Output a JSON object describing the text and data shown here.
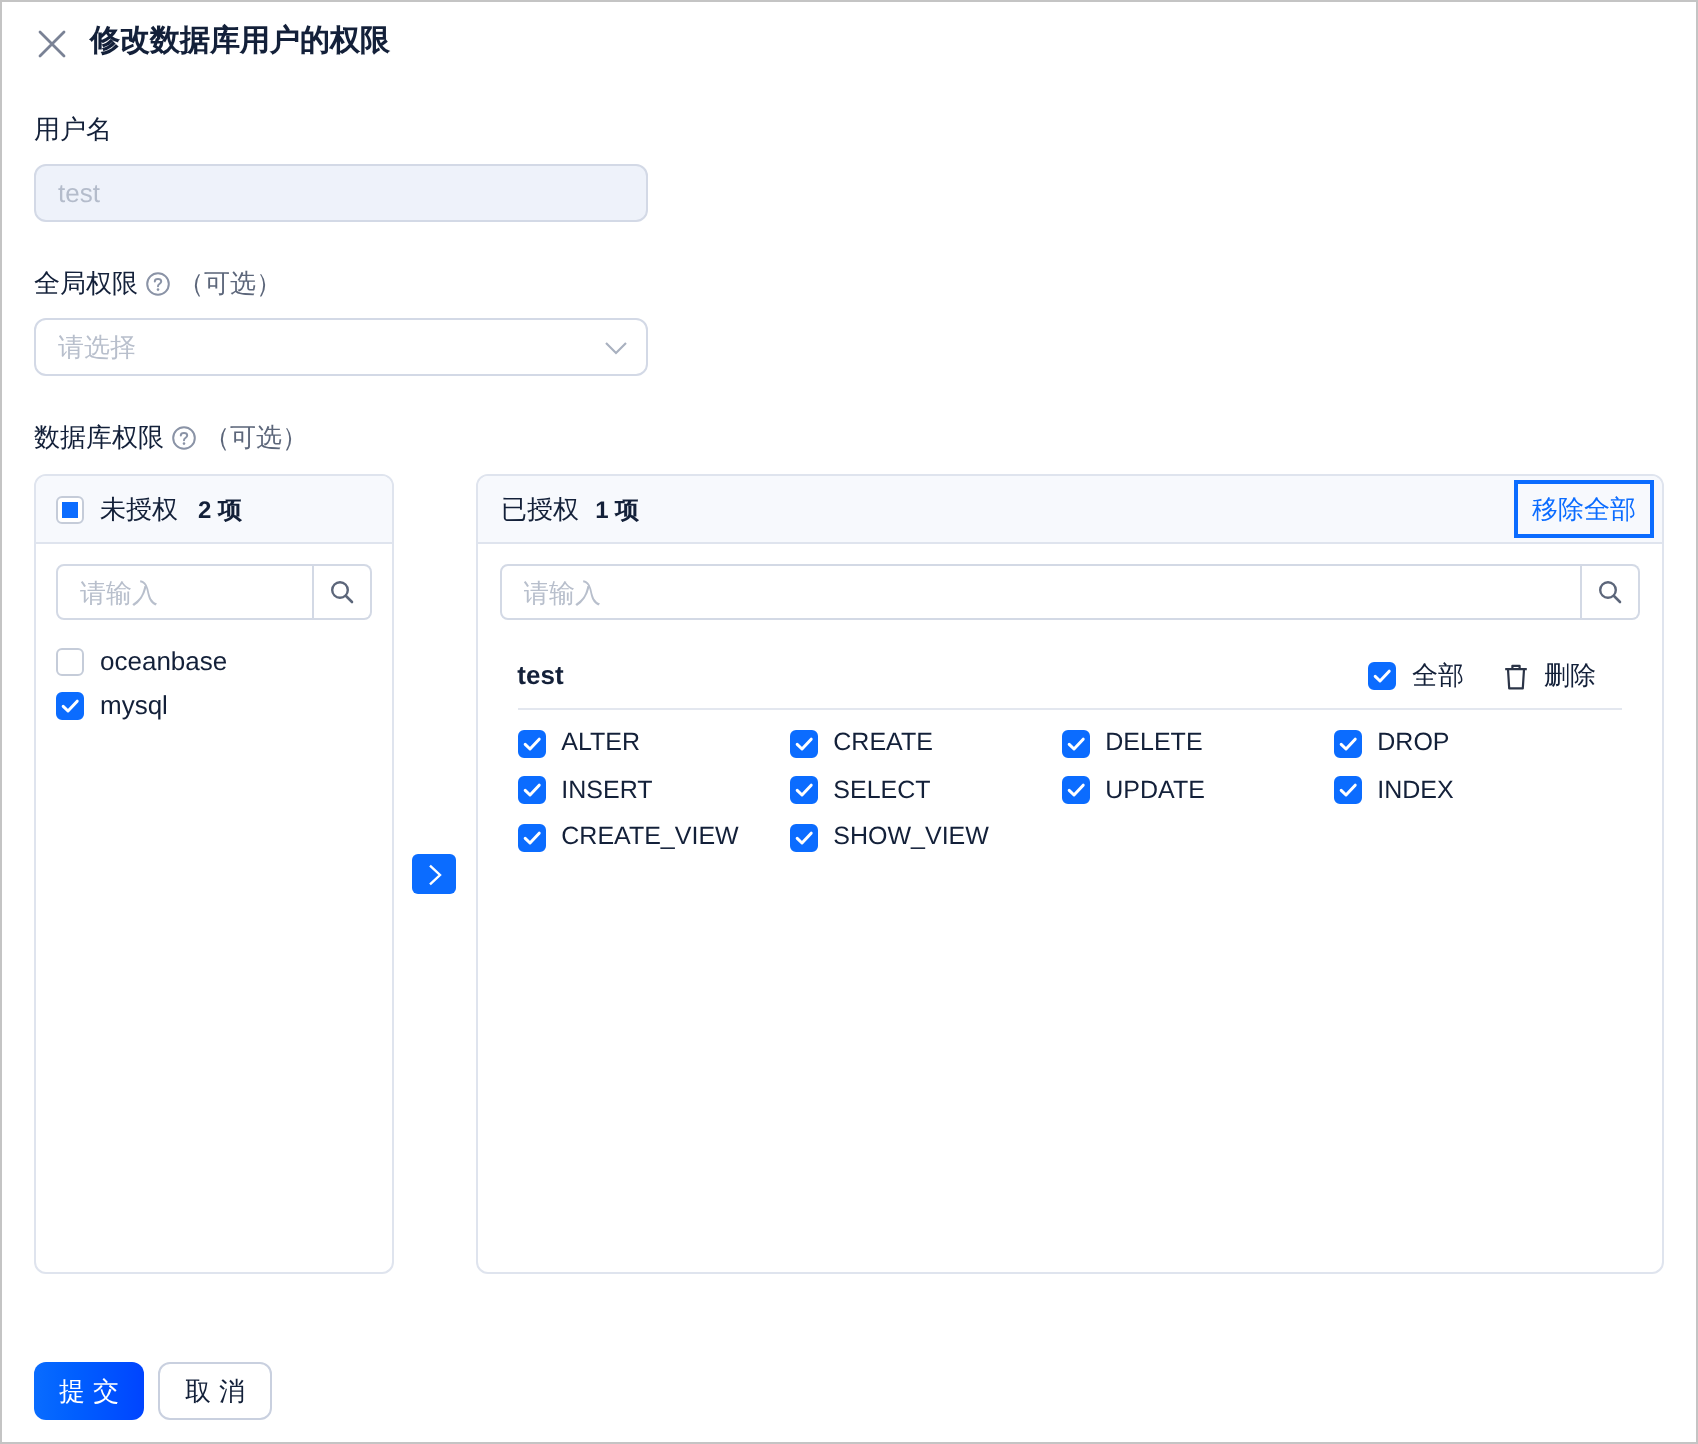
{
  "window": {
    "title": "修改数据库用户的权限"
  },
  "username": {
    "label": "用户名",
    "value": "test",
    "disabled": true
  },
  "global_privileges": {
    "label": "全局权限",
    "optional": "（可选）",
    "placeholder": "请选择"
  },
  "database_privileges": {
    "label": "数据库权限",
    "optional": "（可选）",
    "source": {
      "title": "未授权",
      "count": "2 项",
      "select_all": {
        "checked": false,
        "indeterminate": true
      },
      "search_placeholder": "请输入",
      "items": [
        {
          "label": "oceanbase",
          "checked": false
        },
        {
          "label": "mysql",
          "checked": true
        }
      ]
    },
    "target": {
      "title": "已授权",
      "count": "1 项",
      "remove_all": {
        "label": "移除全部",
        "focused": true
      },
      "search_placeholder": "请输入",
      "groups": [
        {
          "name": "test",
          "select_all": {
            "label": "全部",
            "checked": true
          },
          "delete_label": "删除",
          "privileges": [
            {
              "label": "ALTER",
              "checked": true
            },
            {
              "label": "CREATE",
              "checked": true
            },
            {
              "label": "DELETE",
              "checked": true
            },
            {
              "label": "DROP",
              "checked": true
            },
            {
              "label": "INSERT",
              "checked": true
            },
            {
              "label": "SELECT",
              "checked": true
            },
            {
              "label": "UPDATE",
              "checked": true
            },
            {
              "label": "INDEX",
              "checked": true
            },
            {
              "label": "CREATE_VIEW",
              "checked": true
            },
            {
              "label": "SHOW_VIEW",
              "checked": true
            }
          ]
        }
      ]
    }
  },
  "footer": {
    "buttons": [
      {
        "label": "提 交",
        "kind": "primary"
      },
      {
        "label": "取 消",
        "kind": "default"
      }
    ]
  }
}
